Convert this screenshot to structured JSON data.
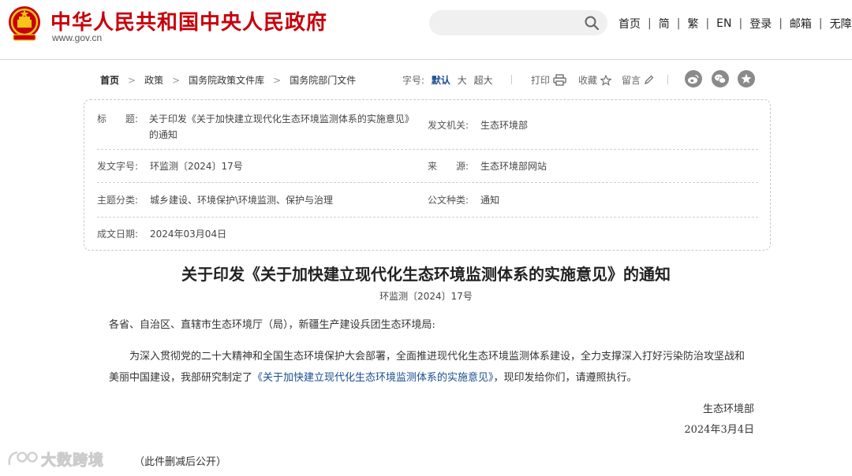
{
  "header": {
    "site_title": "中华人民共和国中央人民政府",
    "site_url": "www.gov.cn",
    "search_placeholder": "",
    "nav": [
      "首页",
      "简",
      "繁",
      "EN",
      "登录",
      "邮箱",
      "无障碍"
    ]
  },
  "breadcrumb": [
    "首页",
    "政策",
    "国务院政策文件库",
    "国务院部门文件"
  ],
  "font_size": {
    "label": "字号:",
    "options": [
      "默认",
      "大",
      "超大"
    ],
    "selected": "默认"
  },
  "tools": {
    "print": "打印",
    "favorite": "收藏",
    "comment": "留言"
  },
  "share_icons": [
    "weibo-icon",
    "wechat-icon",
    "star-icon"
  ],
  "info": {
    "title_label": "标　　题:",
    "title_value": "关于印发《关于加快建立现代化生态环境监测体系的实施意见》的通知",
    "issuer_label": "发文机关:",
    "issuer_value": "生态环境部",
    "docno_label": "发文字号:",
    "docno_value": "环监测〔2024〕17号",
    "source_label": "来　　源:",
    "source_value": "生态环境部网站",
    "topic_label": "主题分类:",
    "topic_value": "城乡建设、环境保护\\环境监测、保护与治理",
    "type_label": "公文种类:",
    "type_value": "通知",
    "date_label": "成文日期:",
    "date_value": "2024年03月04日"
  },
  "article": {
    "title": "关于印发《关于加快建立现代化生态环境监测体系的实施意见》的通知",
    "doc_no": "环监测〔2024〕17号",
    "salutation": "各省、自治区、直辖市生态环境厅（局），新疆生产建设兵团生态环境局:",
    "body_before": "为深入贯彻党的二十大精神和全国生态环境保护大会部署，全面推进现代化生态环境监测体系建设，全力支撑深入打好污染防治攻坚战和美丽中国建设，我部研究制定了",
    "body_link": "《关于加快建立现代化生态环境监测体系的实施意见》",
    "body_after": "，现印发给你们，请遵照执行。",
    "signer": "生态环境部",
    "sign_date": "2024年3月4日",
    "note": "（此件删减后公开）"
  },
  "watermark_text": "大数跨境",
  "colors": {
    "brand_red": "#c7000b",
    "link_blue": "#1a4d8f",
    "share_gray": "#8a8a8a"
  }
}
